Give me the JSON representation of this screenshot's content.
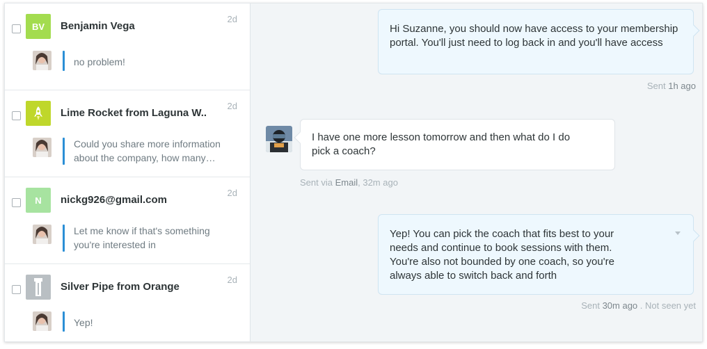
{
  "conversations": [
    {
      "name": "Benjamin Vega",
      "initials": "BV",
      "avatar_color": "#a3dc4f",
      "age": "2d",
      "preview": "no problem!"
    },
    {
      "name": "Lime Rocket from Laguna W..",
      "initials": "",
      "avatar_color": "#bfd72b",
      "avatar_icon": "rocket-icon",
      "age": "2d",
      "preview": "Could you share more information about the company, how many…"
    },
    {
      "name": "nickg926@gmail.com",
      "initials": "N",
      "avatar_color": "#a7e3a0",
      "age": "2d",
      "preview": "Let me know if that's something you're interested in"
    },
    {
      "name": "Silver Pipe from Orange",
      "initials": "",
      "avatar_color": "#b9bfc3",
      "avatar_icon": "pipe-icon",
      "age": "2d",
      "preview": "Yep!"
    }
  ],
  "thread": {
    "messages": [
      {
        "direction": "outgoing",
        "text": "Hi Suzanne, you should now have access to your membership portal. You'll just need to log back in and you'll have access",
        "meta_prefix": "Sent",
        "meta_time": "1h ago"
      },
      {
        "direction": "incoming",
        "text": "I have one more lesson tomorrow and then what do I do pick a coach?",
        "meta_prefix": "Sent via",
        "meta_channel": "Email",
        "meta_time": ", 32m ago"
      },
      {
        "direction": "outgoing",
        "text": "Yep! You can pick the coach that fits best to your needs and continue to book sessions with them. You're also not bounded by one coach, so you're always able to switch back and forth",
        "meta_prefix": "Sent",
        "meta_time": "30m ago",
        "meta_status": ". Not seen yet"
      }
    ]
  },
  "colors": {
    "accent_bar": "#2b8fd6",
    "outgoing_bubble": "#eef8fe",
    "thread_bg": "#f2f5f7"
  }
}
